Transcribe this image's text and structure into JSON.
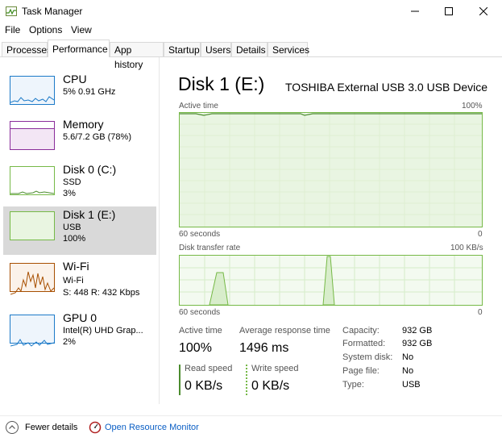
{
  "window": {
    "title": "Task Manager"
  },
  "menu": [
    "File",
    "Options",
    "View"
  ],
  "tabs": [
    {
      "label": "Processes"
    },
    {
      "label": "Performance"
    },
    {
      "label": "App history"
    },
    {
      "label": "Startup"
    },
    {
      "label": "Users"
    },
    {
      "label": "Details"
    },
    {
      "label": "Services"
    }
  ],
  "sidebar": {
    "items": [
      {
        "name": "CPU",
        "sub1": "5%  0.91 GHz",
        "sub2": ""
      },
      {
        "name": "Memory",
        "sub1": "5.6/7.2 GB (78%)",
        "sub2": ""
      },
      {
        "name": "Disk 0 (C:)",
        "sub1": "SSD",
        "sub2": "3%"
      },
      {
        "name": "Disk 1 (E:)",
        "sub1": "USB",
        "sub2": "100%"
      },
      {
        "name": "Wi-Fi",
        "sub1": "Wi-Fi",
        "sub2": "S: 448  R: 432 Kbps"
      },
      {
        "name": "GPU 0",
        "sub1": "Intel(R) UHD Grap...",
        "sub2": "2%"
      }
    ]
  },
  "main": {
    "title": "Disk 1 (E:)",
    "model": "TOSHIBA External USB 3.0 USB Device",
    "graph1": {
      "label": "Active time",
      "max": "100%",
      "time": "60 seconds",
      "min": "0"
    },
    "graph2": {
      "label": "Disk transfer rate",
      "max": "100 KB/s",
      "time": "60 seconds",
      "min": "0"
    },
    "stats": {
      "active_time_label": "Active time",
      "active_time": "100%",
      "avg_response_label": "Average response time",
      "avg_response": "1496 ms",
      "read_label": "Read speed",
      "read": "0 KB/s",
      "write_label": "Write speed",
      "write": "0 KB/s"
    },
    "details": [
      {
        "k": "Capacity:",
        "v": "932 GB"
      },
      {
        "k": "Formatted:",
        "v": "932 GB"
      },
      {
        "k": "System disk:",
        "v": "No"
      },
      {
        "k": "Page file:",
        "v": "No"
      },
      {
        "k": "Type:",
        "v": "USB"
      }
    ]
  },
  "footer": {
    "fewer": "Fewer details",
    "open": "Open Resource Monitor"
  },
  "colors": {
    "disk_green": "#76b947",
    "cpu_blue": "#1c7ac8",
    "memory_purple": "#8a2c9a",
    "wifi_orange": "#a74f01",
    "link_blue": "#0b5fc5"
  },
  "icons": {
    "app": "task-manager-icon",
    "minimize": "minimize-icon",
    "maximize": "maximize-icon",
    "close": "close-icon",
    "fewer": "chevron-up-circle-icon",
    "resource_monitor": "resource-monitor-icon"
  }
}
